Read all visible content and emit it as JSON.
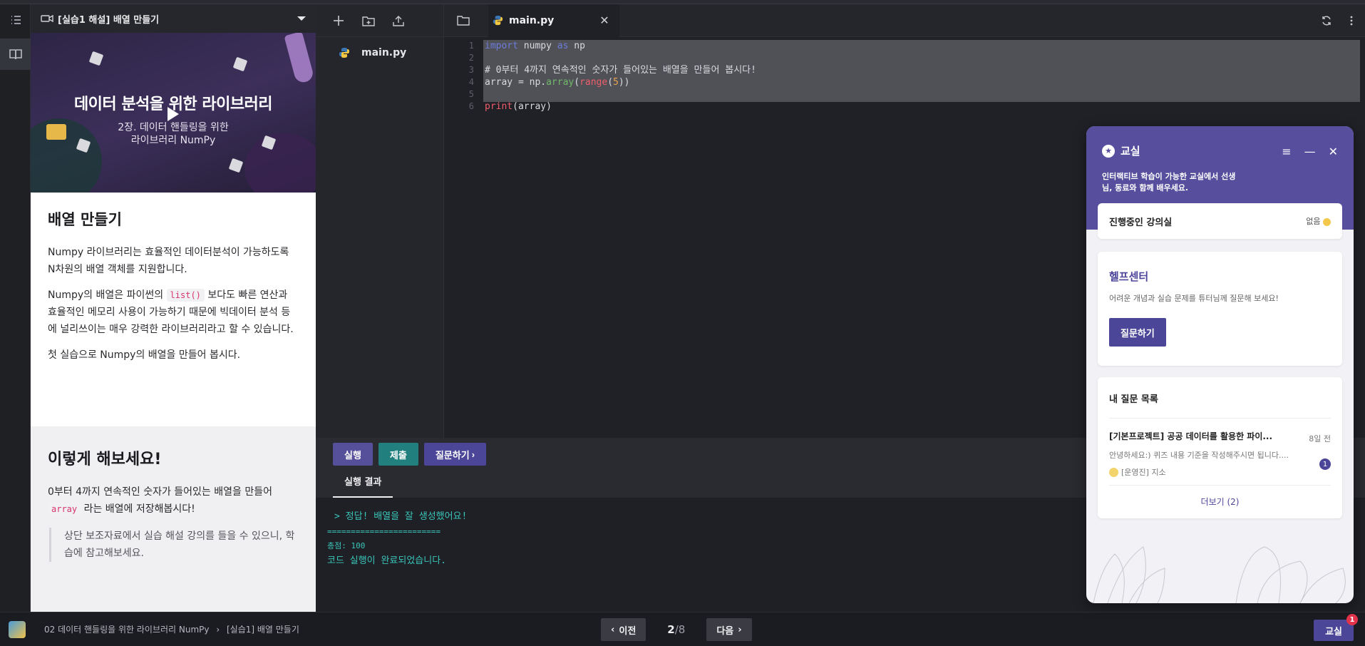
{
  "lesson": {
    "header_title": "[실습1 해설] 배열 만들기",
    "video": {
      "title": "데이터 분석을 위한 라이브러리",
      "subtitle_line1": "2장. 데이터 핸들링을 위한",
      "subtitle_line2": "라이브러리 NumPy"
    },
    "heading": "배열 만들기",
    "para1": "Numpy 라이브러리는 효율적인 데이터분석이 가능하도록 N차원의 배열 객체를 지원합니다.",
    "para2_before": "Numpy의 배열은 파이썬의 ",
    "para2_code": "list()",
    "para2_after": " 보다도 빠른 연산과 효율적인 메모리 사용이 가능하기 때문에 빅데이터 분석 등에 널리쓰이는 매우 강력한 라이브러리라고 할 수 있습니다.",
    "para3": "첫 실습으로 Numpy의 배열을 만들어 봅시다.",
    "try_heading": "이렇게 해보세요!",
    "try_before": "0부터 4까지 연속적인 숫자가 들어있는 배열을 만들어 ",
    "try_code": "array",
    "try_after": " 라는 배열에 저장해봅시다!",
    "try_quote": "상단 보조자료에서 실습 해설 강의를 들을 수 있으니, 학습에 참고해보세요."
  },
  "explorer": {
    "files": [
      "main.py"
    ]
  },
  "editor": {
    "tab_label": "main.py",
    "line_numbers": [
      "1",
      "2",
      "3",
      "4",
      "5",
      "6"
    ],
    "line1": {
      "kw1": "import",
      "mid": " numpy ",
      "kw2": "as",
      "end": " np"
    },
    "line3": "# 0부터 4까지 연속적인 숫자가 들어있는 배열을 만들어 봅시다!",
    "line4": {
      "a": "array = np.",
      "fn": "array",
      "b": "(",
      "rd": "range",
      "c": "(",
      "num": "5",
      "d": "))"
    },
    "line6": {
      "rd": "print",
      "rest": "(array)"
    }
  },
  "runbar": {
    "run": "실행",
    "submit": "제출",
    "ask": "질문하기"
  },
  "output": {
    "tab": "실행 결과",
    "line1": "> 정답! 배열을 잘 생성했어요!",
    "line2": "========================",
    "line3": "총점: 100",
    "line4": "코드 실행이 완료되었습니다."
  },
  "bottom": {
    "crumb1": "02 데이터 핸들링을 위한 라이브러리 NumPy",
    "crumb_sep": "›",
    "crumb2": "[실습1] 배열 만들기",
    "prev": "이전",
    "next": "다음",
    "page_current": "2",
    "page_total": "/8",
    "classroom": "교실",
    "classroom_badge": "1"
  },
  "widget": {
    "title": "교실",
    "desc": "인터랙티브 학습이 가능한 교실에서 선생님, 동료와 함께 배우세요.",
    "live_label": "진행중인 강의실",
    "live_status": "없음",
    "help_title": "헬프센터",
    "help_desc": "어려운 개념과 실습 문제를 튜터님께 질문해 보세요!",
    "help_button": "질문하기",
    "qlist_title": "내 질문 목록",
    "question": {
      "title": "[기본프로젝트] 공공 데이터를 활용한 파이...",
      "time": "8일 전",
      "snippet": "안녕하세요:) 퀴즈 내용 기준을 작성해주시면 됩니다....",
      "user": "[운영진] 지소",
      "count": "1"
    },
    "more": "더보기 (2)"
  },
  "colors": {
    "accent": "#4b4697",
    "submit": "#217f7d",
    "output_text": "#39c4b8",
    "widget_header": "#574e9e"
  }
}
